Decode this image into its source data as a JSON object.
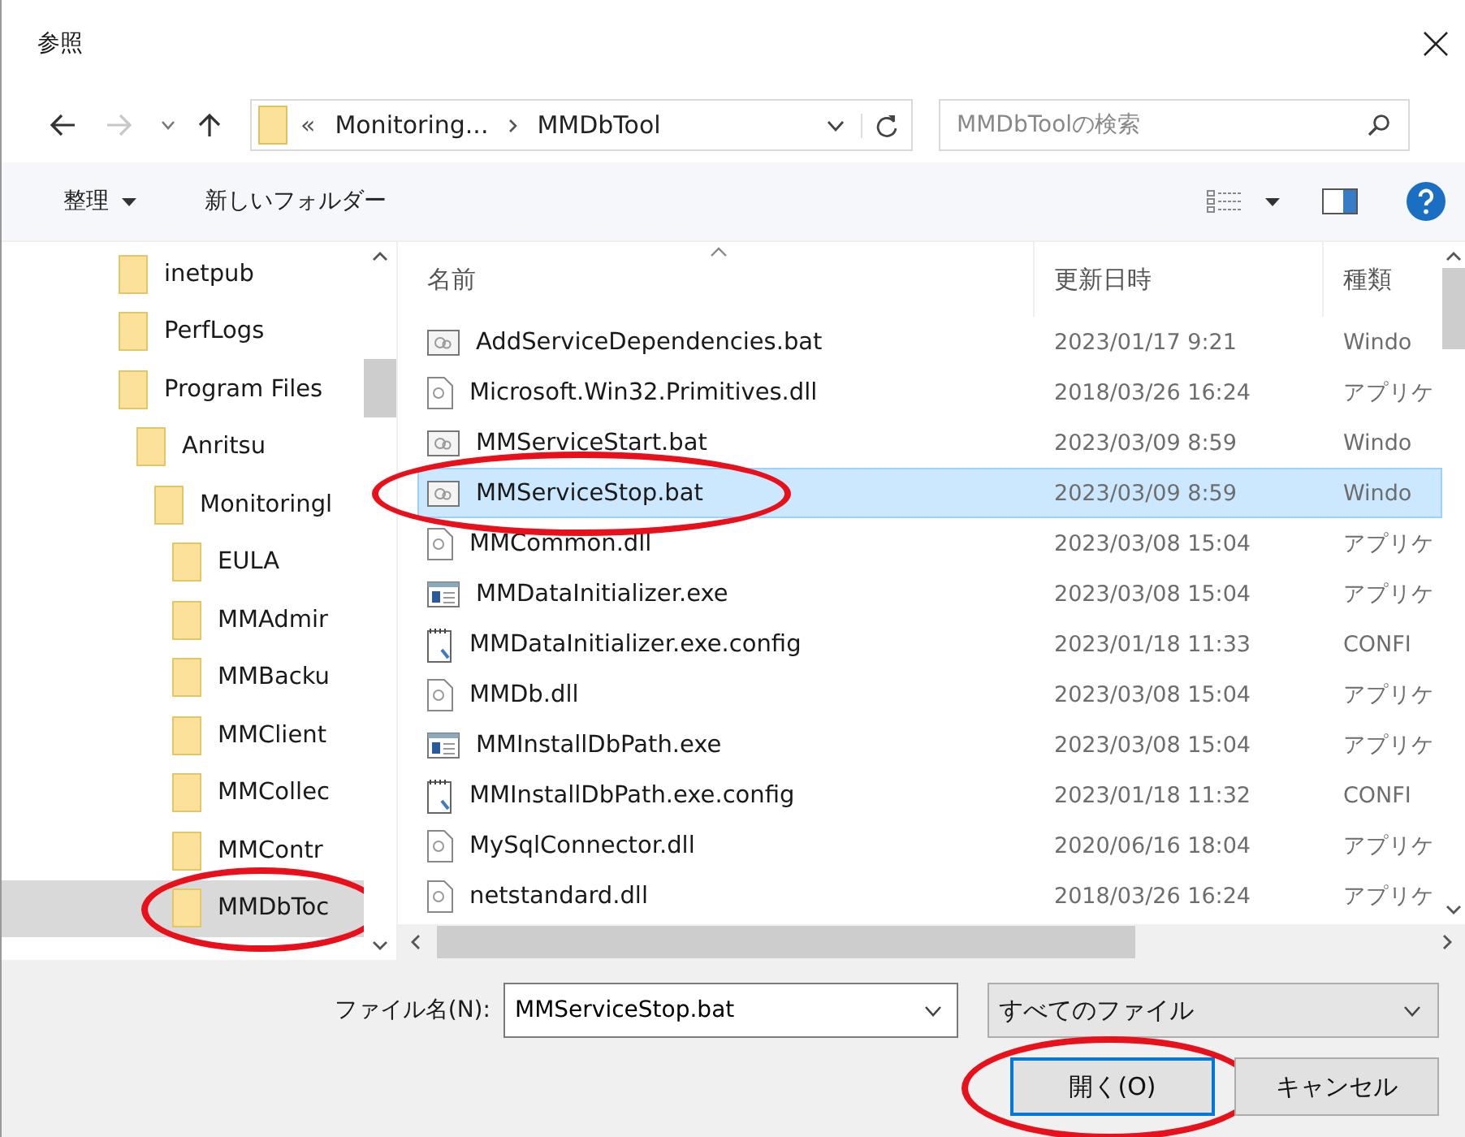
{
  "window": {
    "title": "参照"
  },
  "address": {
    "overflow": "«",
    "crumbs": [
      "Monitoring...",
      "MMDbTool"
    ]
  },
  "search": {
    "placeholder": "MMDbToolの検索"
  },
  "toolbar": {
    "organize": "整理",
    "new_folder": "新しいフォルダー"
  },
  "tree": [
    {
      "label": "inetpub",
      "selected": false,
      "highlighted": false
    },
    {
      "label": "PerfLogs",
      "selected": false,
      "highlighted": false
    },
    {
      "label": "Program Files",
      "selected": false,
      "highlighted": false,
      "children": [
        {
          "label": "Anritsu",
          "selected": false,
          "highlighted": false,
          "children": [
            {
              "label": "Monitoringl",
              "selected": false,
              "highlighted": false,
              "children": [
                {
                  "label": "EULA",
                  "selected": false,
                  "highlighted": false
                },
                {
                  "label": "MMAdmir",
                  "selected": false,
                  "highlighted": false
                },
                {
                  "label": "MMBacku",
                  "selected": false,
                  "highlighted": false
                },
                {
                  "label": "MMClient",
                  "selected": false,
                  "highlighted": false
                },
                {
                  "label": "MMCollec",
                  "selected": false,
                  "highlighted": false
                },
                {
                  "label": "MMContr",
                  "selected": false,
                  "highlighted": false
                },
                {
                  "label": "MMDbToc",
                  "selected": true,
                  "highlighted": true
                }
              ]
            }
          ]
        }
      ]
    }
  ],
  "columns": [
    "名前",
    "更新日時",
    "種類"
  ],
  "files": [
    {
      "name": "AddServiceDependencies.bat",
      "date": "2023/01/17 9:21",
      "type": "Windo",
      "kind": "bat",
      "selected": false,
      "highlighted": false
    },
    {
      "name": "Microsoft.Win32.Primitives.dll",
      "date": "2018/03/26 16:24",
      "type": "アプリケ",
      "kind": "dll",
      "selected": false,
      "highlighted": false
    },
    {
      "name": "MMServiceStart.bat",
      "date": "2023/03/09 8:59",
      "type": "Windo",
      "kind": "bat",
      "selected": false,
      "highlighted": false
    },
    {
      "name": "MMServiceStop.bat",
      "date": "2023/03/09 8:59",
      "type": "Windo",
      "kind": "bat",
      "selected": true,
      "highlighted": true
    },
    {
      "name": "MMCommon.dll",
      "date": "2023/03/08 15:04",
      "type": "アプリケ",
      "kind": "dll",
      "selected": false,
      "highlighted": false
    },
    {
      "name": "MMDataInitializer.exe",
      "date": "2023/03/08 15:04",
      "type": "アプリケ",
      "kind": "exe",
      "selected": false,
      "highlighted": false
    },
    {
      "name": "MMDataInitializer.exe.config",
      "date": "2023/01/18 11:33",
      "type": "CONFI",
      "kind": "config",
      "selected": false,
      "highlighted": false
    },
    {
      "name": "MMDb.dll",
      "date": "2023/03/08 15:04",
      "type": "アプリケ",
      "kind": "dll",
      "selected": false,
      "highlighted": false
    },
    {
      "name": "MMInstallDbPath.exe",
      "date": "2023/03/08 15:04",
      "type": "アプリケ",
      "kind": "exe",
      "selected": false,
      "highlighted": false
    },
    {
      "name": "MMInstallDbPath.exe.config",
      "date": "2023/01/18 11:32",
      "type": "CONFI",
      "kind": "config",
      "selected": false,
      "highlighted": false
    },
    {
      "name": "MySqlConnector.dll",
      "date": "2020/06/16 18:04",
      "type": "アプリケ",
      "kind": "dll",
      "selected": false,
      "highlighted": false
    },
    {
      "name": "netstandard.dll",
      "date": "2018/03/26 16:24",
      "type": "アプリケ",
      "kind": "dll",
      "selected": false,
      "highlighted": false
    }
  ],
  "filename": {
    "label": "ファイル名(N):",
    "value": "MMServiceStop.bat"
  },
  "filter": {
    "value": "すべてのファイル"
  },
  "buttons": [
    {
      "label": "開く(O)",
      "default": true,
      "highlighted": true
    },
    {
      "label": "キャンセル",
      "default": false,
      "highlighted": false
    }
  ]
}
